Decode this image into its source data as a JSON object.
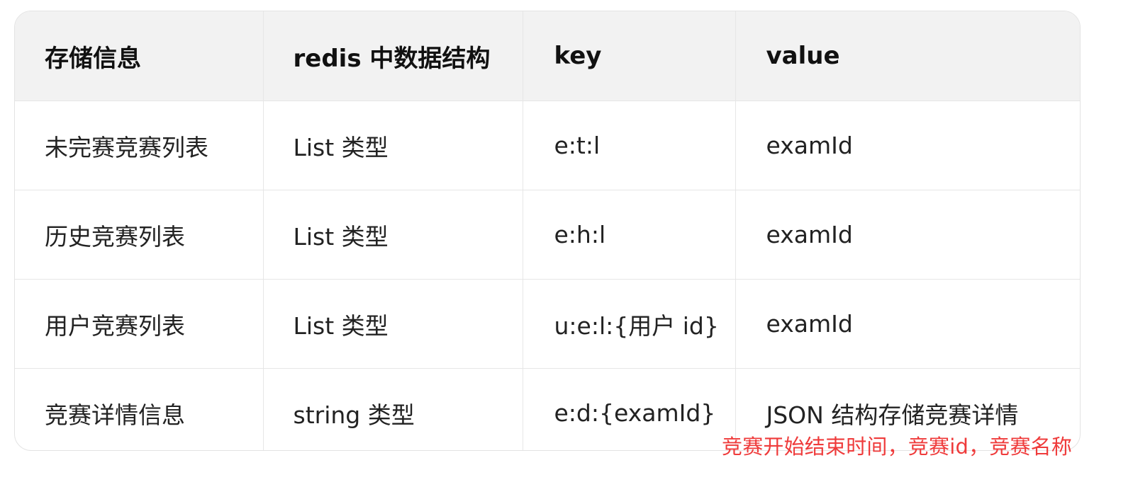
{
  "table": {
    "headers": [
      "存储信息",
      "redis 中数据结构",
      "key",
      "value"
    ],
    "rows": [
      [
        "未完赛竞赛列表",
        "List 类型",
        "e:t:l",
        "examId"
      ],
      [
        "历史竞赛列表",
        "List 类型",
        "e:h:l",
        "examId"
      ],
      [
        "用户竞赛列表",
        "List 类型",
        "u:e:l:{用户 id}",
        "examId"
      ],
      [
        "竞赛详情信息",
        "string 类型",
        "e:d:{examId}",
        "JSON 结构存储竞赛详情"
      ]
    ]
  },
  "annotation": {
    "text": "竞赛开始结束时间，竞赛id，竞赛名称",
    "color": "#ef3b3b"
  }
}
